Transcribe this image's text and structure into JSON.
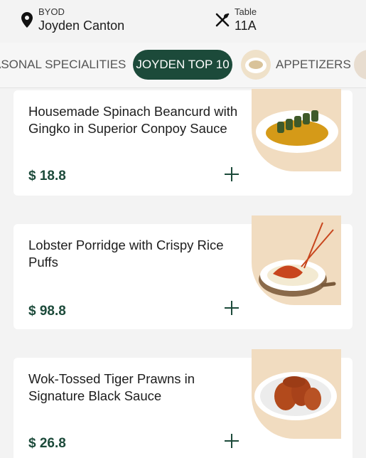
{
  "header": {
    "location_label": "BYOD",
    "location_name": "Joyden Canton",
    "table_label": "Table",
    "table_number": "11A"
  },
  "tabs": [
    {
      "label": "ASONAL SPECIALITIES",
      "active": false
    },
    {
      "label": "JOYDEN TOP 10",
      "active": true
    },
    {
      "label": "APPETIZERS",
      "active": false
    }
  ],
  "colors": {
    "accent": "#1c4a3a",
    "background": "#f3f3f3",
    "photo_bg": "#f1dcc0"
  },
  "items": [
    {
      "name": "Housemade Spinach Beancurd with Gingko in Superior Conpoy Sauce",
      "price": "$ 18.8",
      "image": "spinach-beancurd-image"
    },
    {
      "name": "Lobster Porridge with Crispy Rice Puffs",
      "price": "$ 98.8",
      "image": "lobster-porridge-image"
    },
    {
      "name": "Wok-Tossed Tiger Prawns in Signature Black Sauce",
      "price": "$ 26.8",
      "image": "tiger-prawns-image"
    }
  ]
}
